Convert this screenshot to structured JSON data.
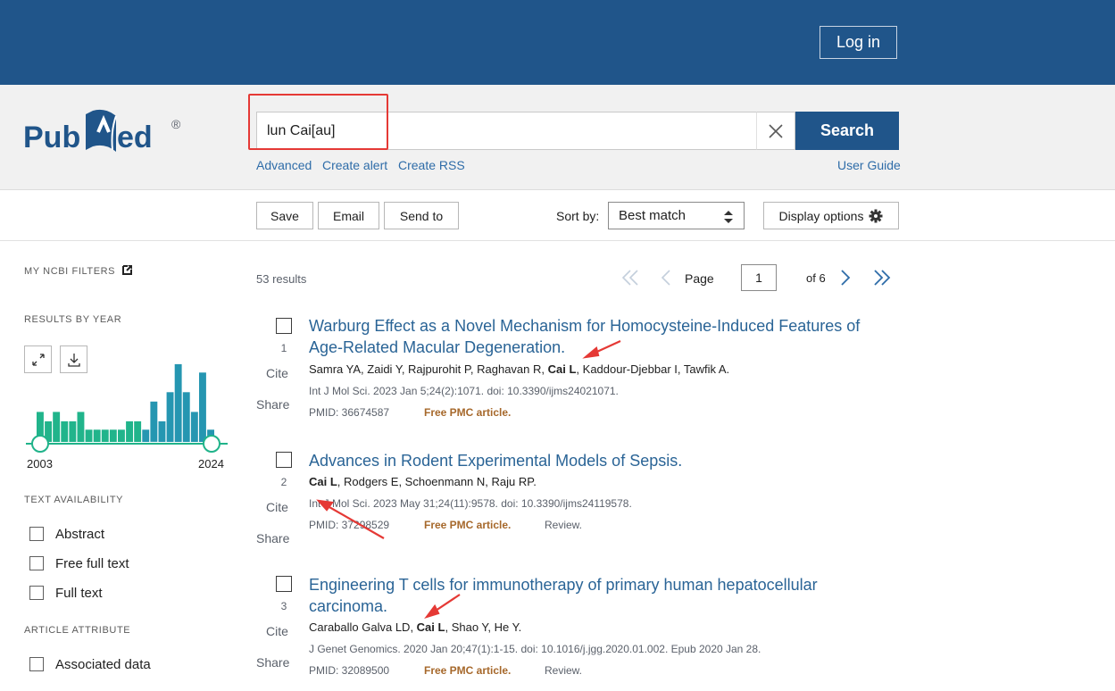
{
  "header": {
    "login_label": "Log in"
  },
  "logo": {
    "text": "PubMed",
    "mark": "®"
  },
  "search": {
    "query": "lun Cai[au]",
    "search_label": "Search",
    "links": [
      "Advanced",
      "Create alert",
      "Create RSS"
    ],
    "user_guide": "User Guide"
  },
  "toolbar": {
    "save": "Save",
    "email": "Email",
    "send_to": "Send to",
    "sort_by_label": "Sort by:",
    "sort_value": "Best match",
    "display_options": "Display options"
  },
  "sidebar": {
    "my_filters": "MY NCBI FILTERS",
    "results_by_year": "RESULTS BY YEAR",
    "year_start": "2003",
    "year_end": "2024",
    "histogram": [
      0.32,
      0.22,
      0.32,
      0.22,
      0.22,
      0.32,
      0.13,
      0.13,
      0.13,
      0.13,
      0.13,
      0.22,
      0.22,
      0.13,
      0.43,
      0.22,
      0.53,
      0.83,
      0.53,
      0.32,
      0.74,
      0.13
    ],
    "text_availability": "TEXT AVAILABILITY",
    "filters": [
      "Abstract",
      "Free full text",
      "Full text"
    ],
    "article_attribute": "ARTICLE ATTRIBUTE",
    "attributes": [
      "Associated data"
    ]
  },
  "results": {
    "count": "53 results",
    "page_label": "Page",
    "page": "1",
    "of_pages": "of 6",
    "items": [
      {
        "num": "1",
        "title_l1": "Warburg Effect as a Novel Mechanism for Homocysteine-Induced Features of",
        "title_l2": "Age-Related Macular Degeneration.",
        "authors_pre": "Samra YA, Zaidi Y, Rajpurohit P, Raghavan R, ",
        "authors_hl": "Cai L",
        "authors_post": ", Kaddour-Djebbar I, Tawfik A.",
        "citation": "Int J Mol Sci. 2023 Jan 5;24(2):1071. doi: 10.3390/ijms24021071.",
        "pmid": "PMID: 36674587",
        "pmc": "Free PMC article.",
        "extra": ""
      },
      {
        "num": "2",
        "title_l1": "Advances in Rodent Experimental Models of Sepsis.",
        "title_l2": "",
        "authors_pre": "",
        "authors_hl": "Cai L",
        "authors_post": ", Rodgers E, Schoenmann N, Raju RP.",
        "citation": "Int J Mol Sci. 2023 May 31;24(11):9578. doi: 10.3390/ijms24119578.",
        "pmid": "PMID: 37298529",
        "pmc": "Free PMC article.",
        "extra": "Review."
      },
      {
        "num": "3",
        "title_l1": "Engineering T cells for immunotherapy of primary human hepatocellular",
        "title_l2": "carcinoma.",
        "authors_pre": "Caraballo Galva LD, ",
        "authors_hl": "Cai L",
        "authors_post": ", Shao Y, He Y.",
        "citation": "J Genet Genomics. 2020 Jan 20;47(1):1-15. doi: 10.1016/j.jgg.2020.01.002. Epub 2020 Jan 28.",
        "pmid": "PMID: 32089500",
        "pmc": "Free PMC article.",
        "extra": "Review."
      }
    ],
    "cite_label": "Cite",
    "share_label": "Share"
  },
  "colors": {
    "brand": "#20558a",
    "link": "#2a6496",
    "pmc": "#a6682b",
    "annotation": "#e53935",
    "histogram": "#20b38a"
  }
}
